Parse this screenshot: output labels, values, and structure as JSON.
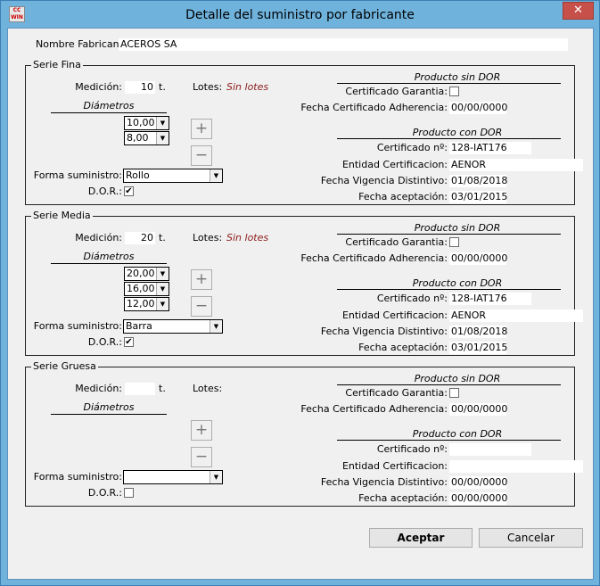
{
  "window": {
    "title": "Detalle del suministro por fabricante",
    "app_icon_text": "CC WIN",
    "close_glyph": "✕"
  },
  "fabricante": {
    "label": "Nombre Fabricante:",
    "value": "ACEROS SA"
  },
  "labels": {
    "medicion": "Medición:",
    "lotes": "Lotes:",
    "diametros": "Diámetros",
    "forma": "Forma suministro:",
    "dor": "D.O.R.:",
    "prod_sin": "Producto sin DOR",
    "cert_garantia": "Certificado Garantia:",
    "fecha_cert_adh": "Fecha Certificado Adherencia:",
    "prod_con": "Producto con DOR",
    "cert_num": "Certificado nº:",
    "entidad": "Entidad Certificacion:",
    "fecha_vig": "Fecha Vigencia Distintivo:",
    "fecha_acep": "Fecha aceptación:",
    "plus": "+",
    "minus": "−"
  },
  "series": [
    {
      "title": "Serie Fina",
      "medicion": "10",
      "unit": "t.",
      "lotes": "Sin lotes",
      "diametros": [
        "10,00",
        "8,00"
      ],
      "forma": "Rollo",
      "dor": "✔",
      "fecha_adh": "00/00/0000",
      "cert_num": "128-IAT176",
      "entidad": "AENOR",
      "fecha_vig": "01/08/2018",
      "fecha_acep": "03/01/2015"
    },
    {
      "title": "Serie Media",
      "medicion": "20",
      "unit": "t.",
      "lotes": "Sin lotes",
      "diametros": [
        "20,00",
        "16,00",
        "12,00"
      ],
      "forma": "Barra",
      "dor": "✔",
      "fecha_adh": "00/00/0000",
      "cert_num": "128-IAT176",
      "entidad": "AENOR",
      "fecha_vig": "01/08/2018",
      "fecha_acep": "03/01/2015"
    },
    {
      "title": "Serie Gruesa",
      "medicion": "",
      "unit": "t.",
      "lotes": "",
      "diametros": [],
      "forma": "",
      "dor": "",
      "fecha_adh": "00/00/0000",
      "cert_num": "",
      "entidad": "",
      "fecha_vig": "00/00/0000",
      "fecha_acep": "00/00/0000"
    }
  ],
  "buttons": {
    "aceptar": "Aceptar",
    "cancelar": "Cancelar"
  }
}
